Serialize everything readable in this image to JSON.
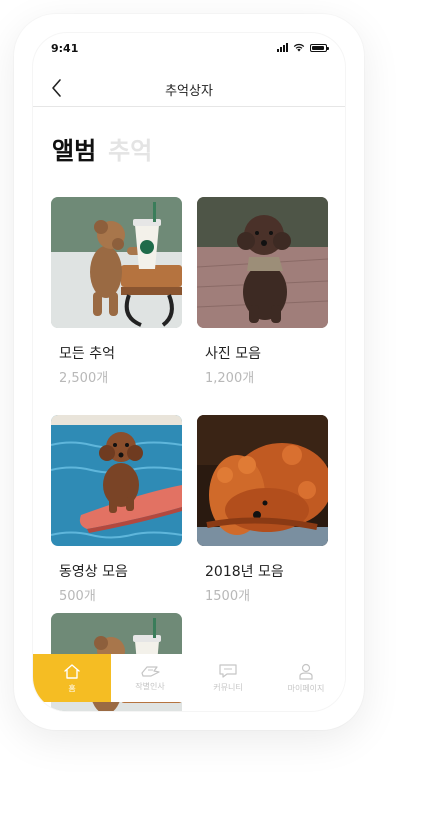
{
  "status": {
    "time": "9:41"
  },
  "nav": {
    "title": "추억상자"
  },
  "tabs": {
    "active": "앨범",
    "inactive": "추억"
  },
  "albums": [
    {
      "title": "모든 추억",
      "count": "2,500개"
    },
    {
      "title": "사진 모음",
      "count": "1,200개"
    },
    {
      "title": "동영상 모음",
      "count": "500개"
    },
    {
      "title": "2018년 모음",
      "count": "1500개"
    }
  ],
  "bottom_nav": [
    {
      "label": "홈",
      "icon": "home-icon",
      "active": true
    },
    {
      "label": "작별인사",
      "icon": "wave-icon"
    },
    {
      "label": "커뮤니티",
      "icon": "chat-icon"
    },
    {
      "label": "마이페이지",
      "icon": "person-icon"
    }
  ],
  "colors": {
    "accent": "#f5bd23",
    "muted": "#c5c5c5"
  }
}
